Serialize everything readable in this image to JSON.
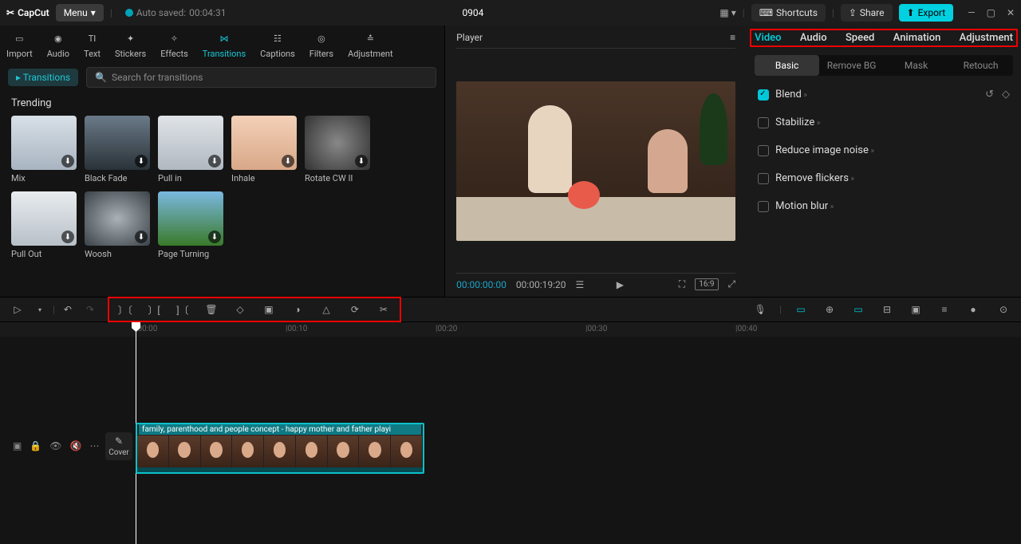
{
  "titlebar": {
    "app_name": "CapCut",
    "menu_label": "Menu",
    "autosave_label": "Auto saved:",
    "autosave_time": "00:04:31",
    "project_title": "0904",
    "shortcuts_label": "Shortcuts",
    "share_label": "Share",
    "export_label": "Export"
  },
  "tool_tabs": [
    {
      "label": "Import",
      "icon": "import"
    },
    {
      "label": "Audio",
      "icon": "audio"
    },
    {
      "label": "Text",
      "icon": "text"
    },
    {
      "label": "Stickers",
      "icon": "stickers"
    },
    {
      "label": "Effects",
      "icon": "effects"
    },
    {
      "label": "Transitions",
      "icon": "transitions",
      "active": true
    },
    {
      "label": "Captions",
      "icon": "captions"
    },
    {
      "label": "Filters",
      "icon": "filters"
    },
    {
      "label": "Adjustment",
      "icon": "adjustment"
    }
  ],
  "left_panel": {
    "subtab_label": "Transitions",
    "search_placeholder": "Search for transitions",
    "section_title": "Trending",
    "items": [
      {
        "label": "Mix",
        "bg": "linear-gradient(180deg,#d8e0e8,#a8b4c0)"
      },
      {
        "label": "Black Fade",
        "bg": "linear-gradient(180deg,#6a7a88,#2a3238)"
      },
      {
        "label": "Pull in",
        "bg": "linear-gradient(180deg,#e0e4e8,#b0b8c0)"
      },
      {
        "label": "Inhale",
        "bg": "linear-gradient(180deg,#f4d0b8,#d8a888)"
      },
      {
        "label": "Rotate CW II",
        "bg": "radial-gradient(circle,#888,#333)"
      },
      {
        "label": "Pull Out",
        "bg": "linear-gradient(180deg,#e8ecef,#b8c0c8)"
      },
      {
        "label": "Woosh",
        "bg": "radial-gradient(ellipse,#aab2b8,#3a4248)"
      },
      {
        "label": "Page Turning",
        "bg": "linear-gradient(180deg,#7ab8e0,#3a7a2a)"
      }
    ]
  },
  "player": {
    "header_label": "Player",
    "current_time": "00:00:00:00",
    "total_time": "00:00:19:20",
    "ratio_label": "16:9"
  },
  "right_panel": {
    "tabs": [
      "Video",
      "Audio",
      "Speed",
      "Animation",
      "Adjustment"
    ],
    "active_tab": "Video",
    "subtabs": [
      "Basic",
      "Remove BG",
      "Mask",
      "Retouch"
    ],
    "active_subtab": "Basic",
    "options": [
      {
        "label": "Blend",
        "checked": true,
        "icons": true
      },
      {
        "label": "Stabilize",
        "checked": false
      },
      {
        "label": "Reduce image noise",
        "checked": false
      },
      {
        "label": "Remove flickers",
        "checked": false
      },
      {
        "label": "Motion blur",
        "checked": false
      }
    ]
  },
  "ruler": {
    "marks": [
      {
        "label": "00:00",
        "pos": 170
      },
      {
        "label": "00:10",
        "pos": 358
      },
      {
        "label": "00:20",
        "pos": 546
      },
      {
        "label": "00:30",
        "pos": 734
      },
      {
        "label": "00:40",
        "pos": 922
      }
    ]
  },
  "timeline": {
    "cover_label": "Cover",
    "clip_label": "family, parenthood and people concept - happy mother and father playi"
  }
}
